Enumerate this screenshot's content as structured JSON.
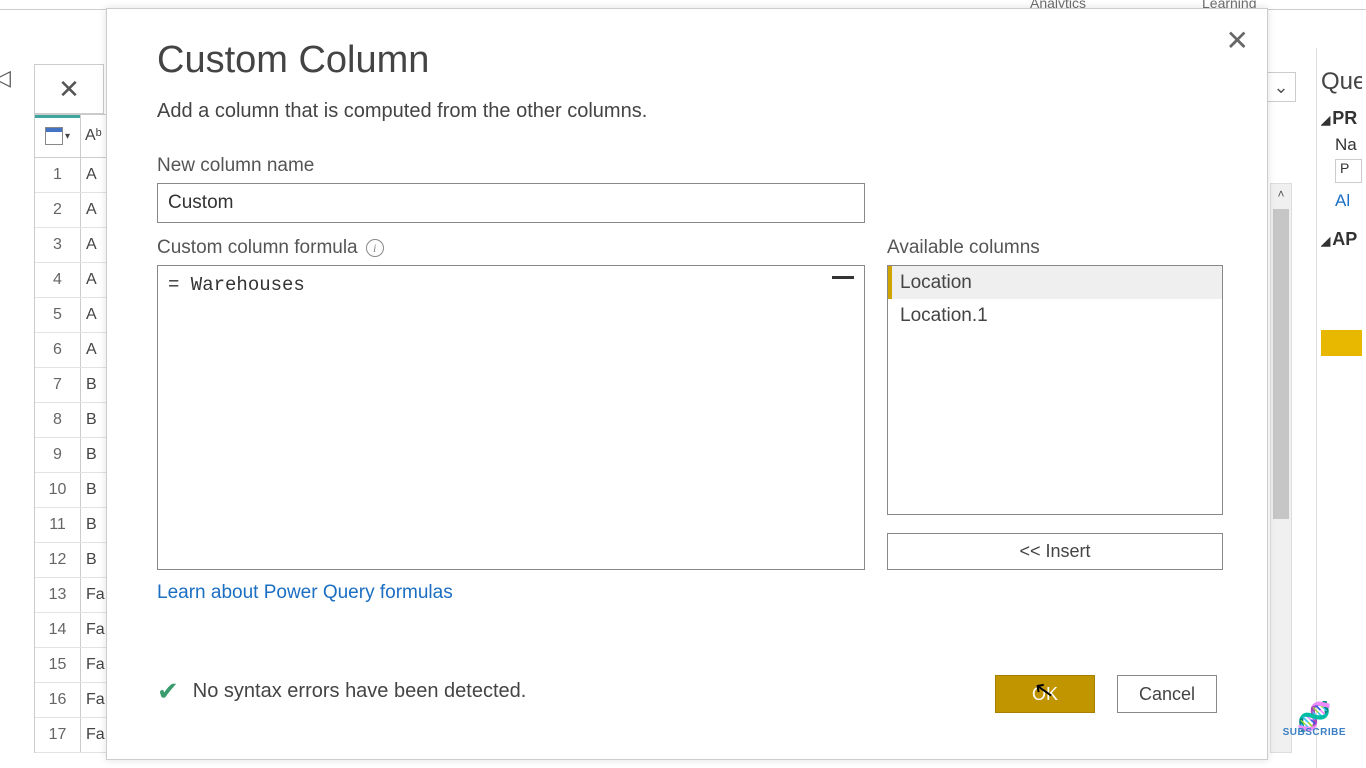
{
  "ribbon": {
    "analytics_label": "Analytics",
    "learning_label": "Learning"
  },
  "grid": {
    "header_col": "Aᵇ",
    "rows": [
      {
        "num": "1",
        "val": "A"
      },
      {
        "num": "2",
        "val": "A"
      },
      {
        "num": "3",
        "val": "A"
      },
      {
        "num": "4",
        "val": "A"
      },
      {
        "num": "5",
        "val": "A"
      },
      {
        "num": "6",
        "val": "A"
      },
      {
        "num": "7",
        "val": "B"
      },
      {
        "num": "8",
        "val": "B"
      },
      {
        "num": "9",
        "val": "B"
      },
      {
        "num": "10",
        "val": "B"
      },
      {
        "num": "11",
        "val": "B"
      },
      {
        "num": "12",
        "val": "B"
      },
      {
        "num": "13",
        "val": "Fa"
      },
      {
        "num": "14",
        "val": "Fa"
      },
      {
        "num": "15",
        "val": "Fa"
      },
      {
        "num": "16",
        "val": "Fa"
      },
      {
        "num": "17",
        "val": "Fa"
      }
    ]
  },
  "dialog": {
    "title": "Custom Column",
    "subtitle": "Add a column that is computed from the other columns.",
    "name_label": "New column name",
    "name_value": "Custom",
    "formula_label": "Custom column formula",
    "formula_value": "= Warehouses",
    "available_label": "Available columns",
    "available_columns": [
      "Location",
      "Location.1"
    ],
    "insert_label": "<< Insert",
    "learn_link": "Learn about Power Query formulas",
    "status_text": "No syntax errors have been detected.",
    "ok_label": "OK",
    "cancel_label": "Cancel"
  },
  "right": {
    "queries_header": "Que",
    "prop_header": "PR",
    "name_label": "Na",
    "name_value": "P",
    "all_link": "Al",
    "applied_header": "AP"
  },
  "subscribe": {
    "label": "SUBSCRIBE"
  }
}
